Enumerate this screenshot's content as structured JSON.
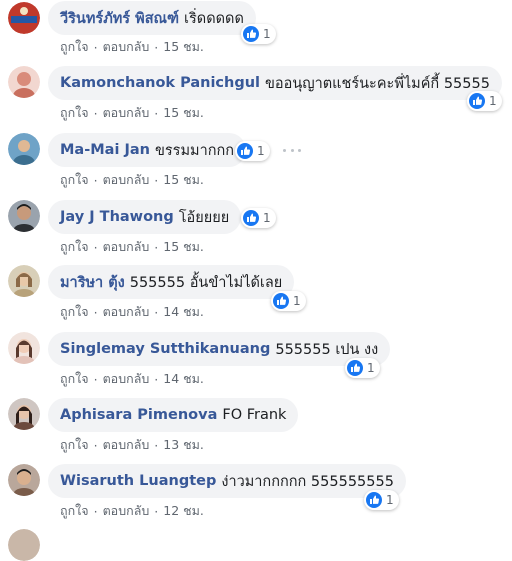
{
  "comments": [
    {
      "author": "วีรินทร์ภัทร์ พิสณฑ์",
      "text": "เริ่ดดดดด",
      "likes": "1",
      "time": "15 ชม.",
      "avatar_color": "#c0392b"
    },
    {
      "author": "Kamonchanok Panichgul",
      "text": "ขออนุญาตแชร์นะคะพี่ไมค์กี้ 55555",
      "likes": "1",
      "time": "15 ชม.",
      "avatar_color": "#d98b7a"
    },
    {
      "author": "Ma-Mai Jan",
      "text": "ขรรมมากกก",
      "likes": "1",
      "time": "15 ชม.",
      "avatar_color": "#3b6e8f"
    },
    {
      "author": "Jay J Thawong",
      "text": "โอ้ยยยย",
      "likes": "1",
      "time": "15 ชม.",
      "avatar_color": "#2c2f33"
    },
    {
      "author": "มาริษา ตุ้ง",
      "text": "555555 อั้นขำไม่ได้เลย",
      "likes": "1",
      "time": "14 ชม.",
      "avatar_color": "#b8a27a"
    },
    {
      "author": "Singlemay Sutthikanuang",
      "text": "555555 เปน งง",
      "likes": "1",
      "time": "14 ชม.",
      "avatar_color": "#e3c2b8"
    },
    {
      "author": "Aphisara Pimenova",
      "text": "FO Frank",
      "likes": "",
      "time": "13 ชม.",
      "avatar_color": "#6b4a3e"
    },
    {
      "author": "Wisaruth Luangtep",
      "text": "ง่าวมากกกกก 555555555",
      "likes": "1",
      "time": "12 ชม.",
      "avatar_color": "#7a5c4a"
    }
  ],
  "actions": {
    "like": "ถูกใจ",
    "reply": "ตอบกลับ",
    "sep": "·"
  },
  "colors": {
    "author": "#385898",
    "like_blue": "#1877f2",
    "bubble": "#f2f3f5",
    "meta": "#606770"
  }
}
